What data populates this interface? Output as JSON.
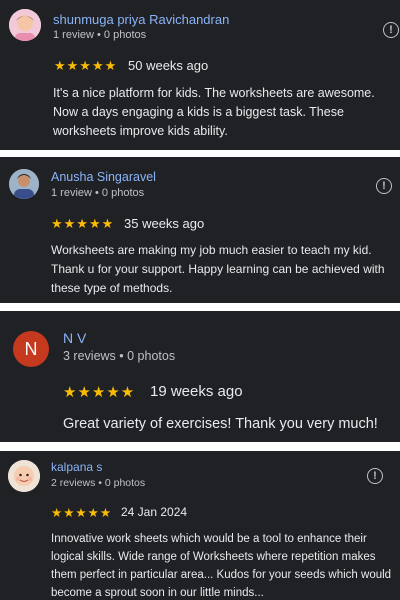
{
  "reviews": [
    {
      "name": "shunmuga priya Ravichandran",
      "meta": "1 review • 0 photos",
      "stars": "★★★★★",
      "date": "50 weeks ago",
      "text": "It's a nice platform for kids. The worksheets are awesome. Now a days engaging a kids is a biggest task. These worksheets improve kids ability.",
      "avatar_icon": "child-photo-avatar"
    },
    {
      "name": "Anusha Singaravel",
      "meta": "1 review • 0 photos",
      "stars": "★★★★★",
      "date": "35 weeks ago",
      "text": "Worksheets are making my job much easier to teach my kid. Thank u for your support. Happy learning can be achieved with these type of methods.",
      "avatar_icon": "person-photo-avatar"
    },
    {
      "name": "N V",
      "meta": "3 reviews • 0 photos",
      "stars": "★★★★★",
      "date": "19 weeks ago",
      "text": "Great variety of exercises! Thank you very much!",
      "avatar_letter": "N",
      "avatar_color": "#c5391e"
    },
    {
      "name": "kalpana s",
      "meta": "2 reviews • 0 photos",
      "stars": "★★★★★",
      "date": "24 Jan 2024",
      "text": "Innovative work sheets which would be a tool to enhance their logical skills. Wide range of Worksheets where repetition makes them perfect in particular area... Kudos for your seeds which would become a sprout soon in our little minds...",
      "avatar_icon": "baby-photo-avatar"
    }
  ],
  "colors": {
    "card_bg": "#202124",
    "name": "#8ab4f8",
    "star": "#fbbc04",
    "meta": "#bdc1c6"
  }
}
